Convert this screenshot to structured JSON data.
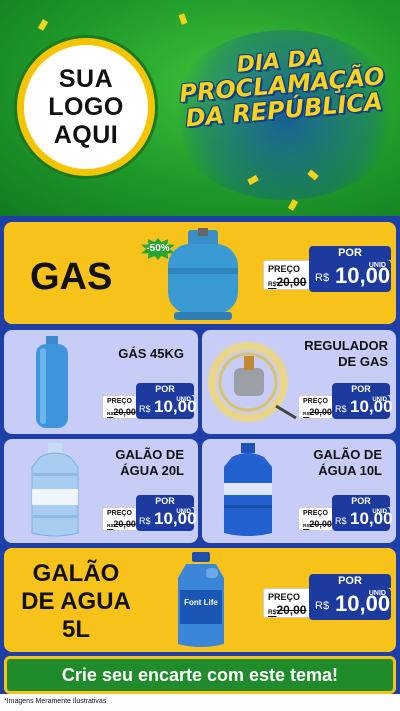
{
  "header": {
    "logo_lines": [
      "SUA",
      "LOGO",
      "AQUI"
    ],
    "title_lines": [
      "DIA DA",
      "PROCLAMAÇÃO",
      "DA REPÚBLICA"
    ]
  },
  "colors": {
    "header_green": "#1f9a2a",
    "main_blue": "#1f3fa8",
    "card_yellow": "#f7c21a",
    "card_lilac": "#c7cdf6",
    "price_blue": "#1d3a9e"
  },
  "products": [
    {
      "name": "GAS",
      "badge": "-50%",
      "price": {
        "preco_label": "PREÇO",
        "por_label": "POR",
        "old": "20,00",
        "old_currency": "R$",
        "currency": "R$",
        "new": "10,00",
        "unit": "UNID"
      },
      "image_icon": "gas-cylinder-icon"
    },
    {
      "name": "GÁS 45KG",
      "price": {
        "preco_label": "PREÇO",
        "por_label": "POR",
        "old": "20,00",
        "old_currency": "R$",
        "currency": "R$",
        "new": "10,00",
        "unit": "UNID"
      },
      "image_icon": "tall-gas-cylinder-icon"
    },
    {
      "name_lines": [
        "REGULADOR",
        "DE GAS"
      ],
      "price": {
        "preco_label": "PREÇO",
        "por_label": "POR",
        "old": "20,00",
        "old_currency": "R$",
        "currency": "R$",
        "new": "10,00",
        "unit": "UNID"
      },
      "image_icon": "gas-regulator-icon"
    },
    {
      "name_lines": [
        "GALÃO DE",
        "ÁGUA 20L"
      ],
      "price": {
        "preco_label": "PREÇO",
        "por_label": "POR",
        "old": "20,00",
        "old_currency": "R$",
        "currency": "R$",
        "new": "10,00",
        "unit": "UNID"
      },
      "image_icon": "water-jug-20l-icon"
    },
    {
      "name_lines": [
        "GALÃO DE",
        "ÁGUA 10L"
      ],
      "price": {
        "preco_label": "PREÇO",
        "por_label": "POR",
        "old": "20,00",
        "old_currency": "R$",
        "currency": "R$",
        "new": "10,00",
        "unit": "UNID"
      },
      "image_icon": "water-jug-10l-icon"
    },
    {
      "name_lines": [
        "GALÃO",
        "DE AGUA",
        "5L"
      ],
      "price": {
        "preco_label": "PREÇO",
        "por_label": "POR",
        "old": "20,00",
        "old_currency": "R$",
        "currency": "R$",
        "new": "10,00",
        "unit": "UNID"
      },
      "image_icon": "water-bottle-5l-icon",
      "bottle_label": "Font Life"
    }
  ],
  "footer": {
    "cta": "Crie seu encarte com este tema!",
    "note": "*Imagens Meramente Ilustrativas"
  }
}
